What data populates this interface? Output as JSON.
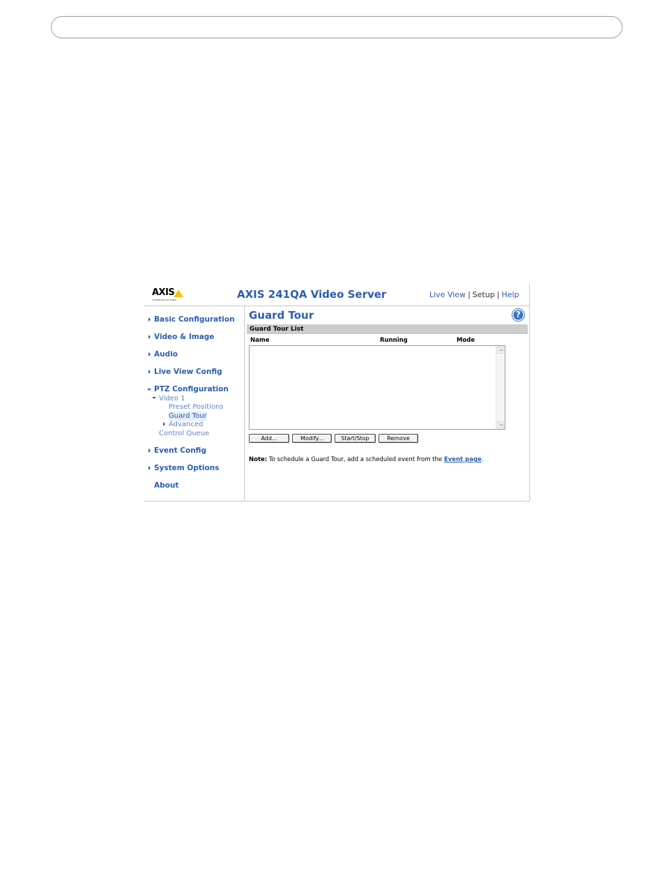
{
  "app": {
    "logo_text": "AXIS",
    "logo_subtext": "COMMUNICATIONS",
    "product_title": "AXIS 241QA Video Server",
    "topnav": {
      "live_view": "Live View",
      "setup": "Setup",
      "help": "Help",
      "separator": "|"
    }
  },
  "sidebar": {
    "items": [
      {
        "label": "Basic Configuration"
      },
      {
        "label": "Video & Image"
      },
      {
        "label": "Audio"
      },
      {
        "label": "Live View Config"
      },
      {
        "label": "PTZ Configuration"
      },
      {
        "label": "Event Config"
      },
      {
        "label": "System Options"
      },
      {
        "label": "About"
      }
    ],
    "ptz_sub": {
      "video1": "Video 1",
      "preset_positions": "Preset Positions",
      "guard_tour": "Guard Tour",
      "advanced": "Advanced",
      "control_queue": "Control Queue"
    }
  },
  "main": {
    "title": "Guard Tour",
    "help_icon": "?",
    "section_title": "Guard Tour List",
    "columns": [
      "Name",
      "Running",
      "Mode"
    ],
    "rows": [],
    "buttons": {
      "add": "Add...",
      "modify": "Modify...",
      "start_stop": "Start/Stop",
      "remove": "Remove"
    },
    "note": {
      "label": "Note:",
      "text": " To schedule a Guard Tour, add a scheduled event from the ",
      "link": "Event page",
      "end": "."
    }
  },
  "colors": {
    "link_blue": "#2a5db0",
    "section_gray": "#cccccc",
    "logo_yellow": "#f5c400"
  }
}
